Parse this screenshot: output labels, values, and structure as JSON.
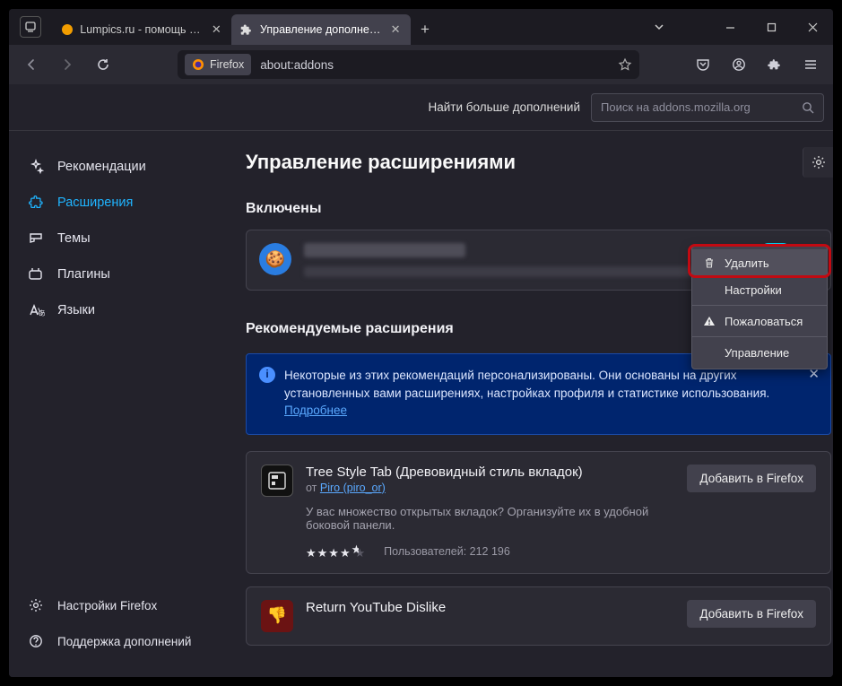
{
  "tabs": [
    {
      "title": "Lumpics.ru - помощь с компь",
      "favicon_color": "#f29d00"
    },
    {
      "title": "Управление дополнениями"
    }
  ],
  "urlbar": {
    "badge": "Firefox",
    "path": "about:addons"
  },
  "search": {
    "label": "Найти больше дополнений",
    "placeholder": "Поиск на addons.mozilla.org"
  },
  "sidebar": {
    "items": [
      {
        "label": "Рекомендации",
        "icon": "sparkle"
      },
      {
        "label": "Расширения",
        "icon": "puzzle",
        "active": true
      },
      {
        "label": "Темы",
        "icon": "brush"
      },
      {
        "label": "Плагины",
        "icon": "plug"
      },
      {
        "label": "Языки",
        "icon": "lang"
      }
    ],
    "bottom": [
      {
        "label": "Настройки Firefox",
        "icon": "gear"
      },
      {
        "label": "Поддержка дополнений",
        "icon": "help"
      }
    ]
  },
  "main": {
    "heading": "Управление расширениями",
    "section_enabled": "Включены",
    "section_recommended": "Рекомендуемые расширения"
  },
  "popup": {
    "remove": "Удалить",
    "settings": "Настройки",
    "report": "Пожаловаться",
    "manage": "Управление"
  },
  "notice": {
    "text_a": "Некоторые из этих рекомендаций персонализированы. Они основаны на других установленных вами расширениях, настройках профиля и статистике использования.  ",
    "link": "Подробнее"
  },
  "rec1": {
    "title": "Tree Style Tab (Древовидный стиль вкладок)",
    "author_prefix": "от ",
    "author": "Piro (piro_or)",
    "desc": "У вас множество открытых вкладок? Организуйте их в удобной боковой панели.",
    "users_label": "Пользователей: 212 196",
    "add": "Добавить в Firefox"
  },
  "rec2": {
    "title": "Return YouTube Dislike",
    "add": "Добавить в Firefox"
  }
}
